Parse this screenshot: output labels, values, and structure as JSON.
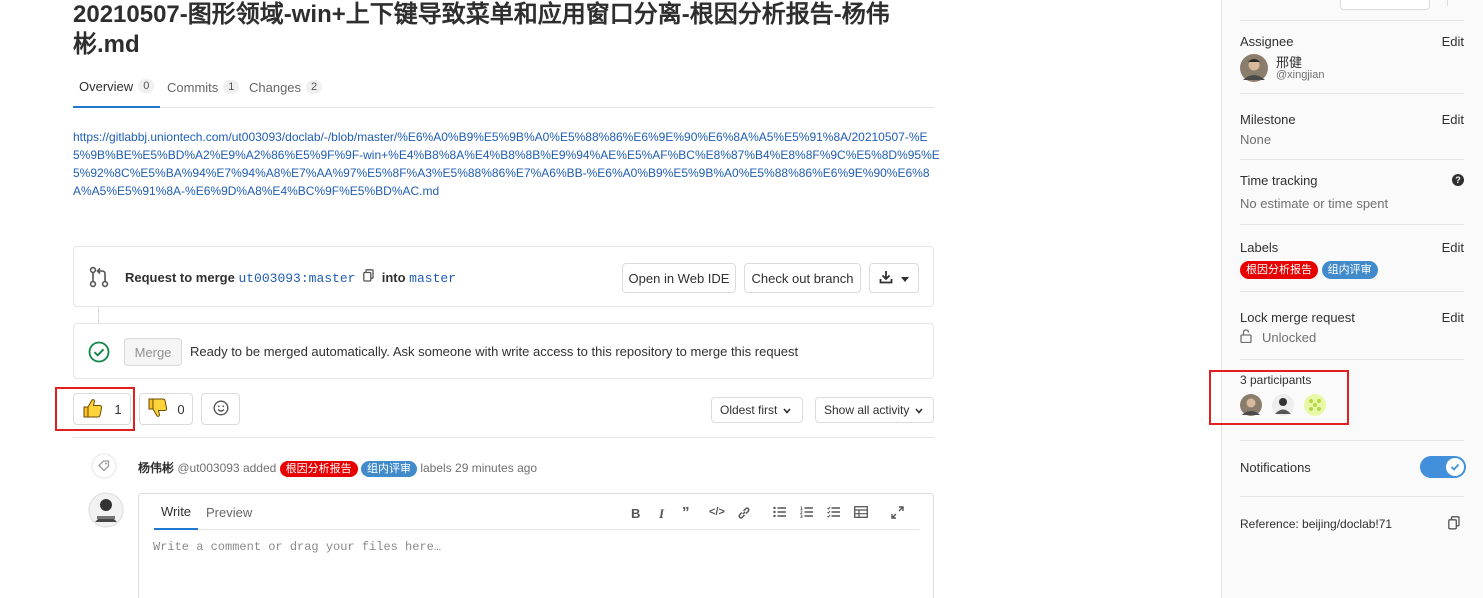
{
  "title": "20210507-图形领域-win+上下键导致菜单和应用窗口分离-根因分析报告-杨伟彬.md",
  "tabs": [
    {
      "label": "Overview",
      "count": "0"
    },
    {
      "label": "Commits",
      "count": "1"
    },
    {
      "label": "Changes",
      "count": "2"
    }
  ],
  "description_link": "https://gitlabbj.uniontech.com/ut003093/doclab/-/blob/master/%E6%A0%B9%E5%9B%A0%E5%88%86%E6%9E%90%E6%8A%A5%E5%91%8A/20210507-%E5%9B%BE%E5%BD%A2%E9%A2%86%E5%9F%9F-win+%E4%B8%8A%E4%B8%8B%E9%94%AE%E5%AF%BC%E8%87%B4%E8%8F%9C%E5%8D%95%E5%92%8C%E5%BA%94%E7%94%A8%E7%AA%97%E5%8F%A3%E5%88%86%E7%A6%BB-%E6%A0%B9%E5%9B%A0%E5%88%86%E6%9E%90%E6%8A%A5%E5%91%8A-%E6%9D%A8%E4%BC%9F%E5%BD%AC.md",
  "merge_widget": {
    "request_to_merge": "Request to merge",
    "source_branch": "ut003093:master",
    "into": "into",
    "target_branch": "master",
    "open_ide": "Open in Web IDE",
    "checkout": "Check out branch"
  },
  "merge_status": {
    "merge_button": "Merge",
    "message": "Ready to be merged automatically. Ask someone with write access to this repository to merge this request"
  },
  "awards": {
    "thumbsup_count": "1",
    "thumbsdown_count": "0",
    "sort_label": "Oldest first",
    "filter_label": "Show all activity"
  },
  "activity": {
    "author": "杨伟彬",
    "handle": "@ut003093",
    "added": "added",
    "label1": "根因分析报告",
    "label2": "组内评审",
    "suffix": "labels 29 minutes ago"
  },
  "comment": {
    "write_tab": "Write",
    "preview_tab": "Preview",
    "placeholder": "Write a comment or drag your files here…",
    "toolbar": [
      "B",
      "I",
      "99",
      "</>",
      "link",
      "ul",
      "ol",
      "task",
      "table",
      "expand"
    ]
  },
  "sidebar": {
    "assignee": {
      "title": "Assignee",
      "edit": "Edit",
      "name": "邢健",
      "handle": "@xingjian"
    },
    "milestone": {
      "title": "Milestone",
      "edit": "Edit",
      "value": "None"
    },
    "time_tracking": {
      "title": "Time tracking",
      "value": "No estimate or time spent"
    },
    "labels": {
      "title": "Labels",
      "edit": "Edit",
      "items": [
        "根因分析报告",
        "组内评审"
      ]
    },
    "lock": {
      "title": "Lock merge request",
      "edit": "Edit",
      "value": "Unlocked"
    },
    "participants": {
      "title": "3 participants"
    },
    "notifications": {
      "title": "Notifications",
      "enabled": true
    },
    "reference": {
      "text": "Reference: beijing/doclab!71"
    }
  },
  "colors": {
    "accent": "#1f78d1",
    "label_red": "#e60000",
    "label_blue": "#428bca",
    "success": "#108548",
    "highlight_box": "#e02020",
    "toggle": "#428fdc"
  }
}
